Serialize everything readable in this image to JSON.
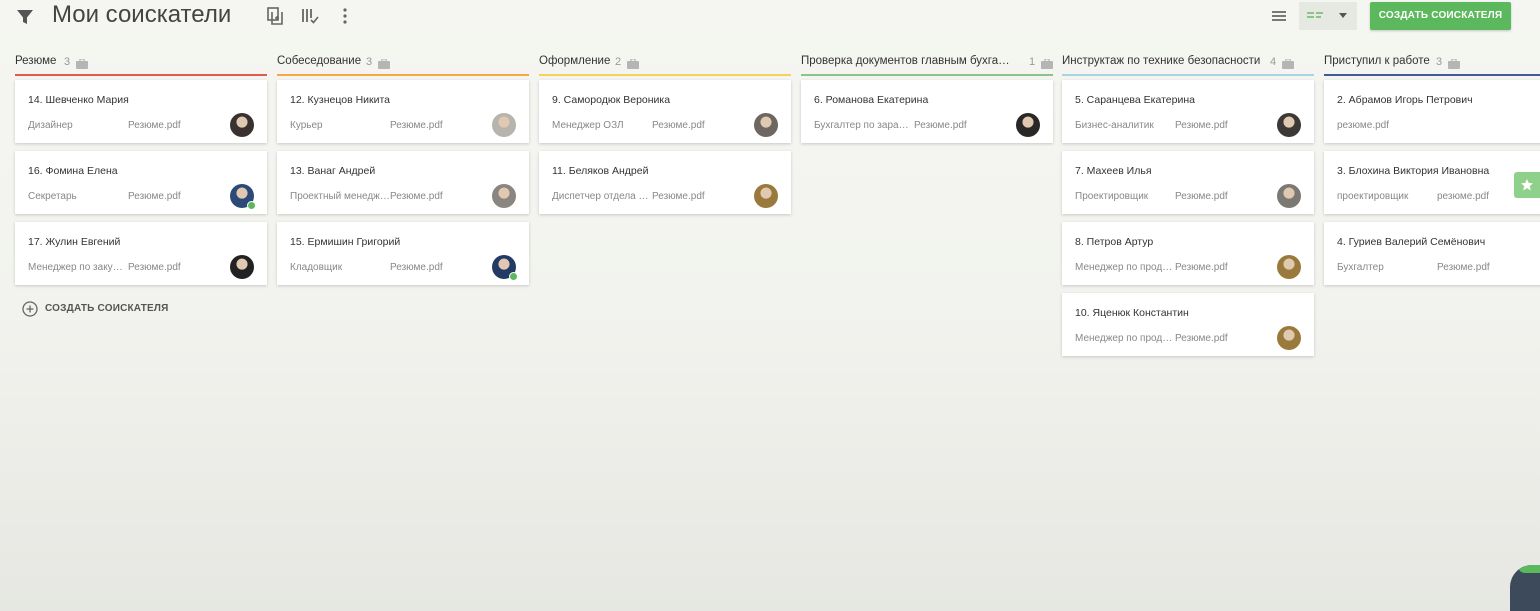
{
  "header": {
    "title": "Мои соискатели",
    "create_button": "СОЗДАТЬ СОИСКАТЕЛЯ"
  },
  "icons": {
    "filter": "filter-icon",
    "copy": "copy-icon",
    "columns": "columns-check-icon",
    "more": "more-vert-icon",
    "list_view": "list-view-icon",
    "board_view": "board-view-icon",
    "bag": "briefcase-icon",
    "star": "star-icon"
  },
  "colors": {
    "accent": "#5cb85c",
    "column_lines": [
      "#e05b4b",
      "#f5a742",
      "#f3d35a",
      "#8bc48a",
      "#a8d4e8",
      "#3f5a99"
    ]
  },
  "columns": [
    {
      "title": "Резюме",
      "count": "3",
      "cards": [
        {
          "name": "14. Шевченко Мария",
          "role": "Дизайнер",
          "resume": "Резюме.pdf",
          "avatar": "#3a3230",
          "online": false
        },
        {
          "name": "16. Фомина Елена",
          "role": "Секретарь",
          "resume": "Резюме.pdf",
          "avatar": "#2c4a78",
          "online": true
        },
        {
          "name": "17. Жулин Евгений",
          "role": "Менеджер по закупкам",
          "resume": "Резюме.pdf",
          "avatar": "#222222",
          "online": false
        }
      ]
    },
    {
      "title": "Собеседование",
      "count": "3",
      "cards": [
        {
          "name": "12. Кузнецов Никита",
          "role": "Курьер",
          "resume": "Резюме.pdf",
          "avatar": "#b7b4ad",
          "online": false
        },
        {
          "name": "13. Ванаг Андрей",
          "role": "Проектный менеджер",
          "resume": "Резюме.pdf",
          "avatar": "#8a8580",
          "online": false
        },
        {
          "name": "15. Ермишин Григорий",
          "role": "Кладовщик",
          "resume": "Резюме.pdf",
          "avatar": "#243a66",
          "online": true
        }
      ]
    },
    {
      "title": "Оформление",
      "count": "2",
      "cards": [
        {
          "name": "9. Самородюк Вероника",
          "role": "Менеджер ОЗЛ",
          "resume": "Резюме.pdf",
          "avatar": "#6e6660",
          "online": false
        },
        {
          "name": "11. Беляков Андрей",
          "role": "Диспетчер отдела логистики",
          "resume": "Резюме.pdf",
          "avatar": "#9a7a3c",
          "online": false
        }
      ]
    },
    {
      "title": "Проверка документов главным бухгалтером",
      "count": "1",
      "cards": [
        {
          "name": "6. Романова Екатерина",
          "role": "Бухгалтер по заработной плате",
          "resume": "Резюме.pdf",
          "avatar": "#2a2826",
          "online": false
        }
      ]
    },
    {
      "title": "Инструктаж по технике безопасности",
      "count": "4",
      "cards": [
        {
          "name": "5. Саранцева Екатерина",
          "role": "Бизнес-аналитик",
          "resume": "Резюме.pdf",
          "avatar": "#3c3836",
          "online": false
        },
        {
          "name": "7. Махеев Илья",
          "role": "Проектировщик",
          "resume": "Резюме.pdf",
          "avatar": "#7c7874",
          "online": false
        },
        {
          "name": "8. Петров Артур",
          "role": "Менеджер по продажам",
          "resume": "Резюме.pdf",
          "avatar": "#9a7a3c",
          "online": false
        },
        {
          "name": "10. Яценюк Константин",
          "role": "Менеджер по продажам",
          "resume": "Резюме.pdf",
          "avatar": "#9a7a3c",
          "online": false
        }
      ]
    },
    {
      "title": "Приступил к работе",
      "count": "3",
      "cards": [
        {
          "name": "2. Абрамов Игорь Петрович",
          "role": "резюме.pdf",
          "resume": "",
          "avatar": "",
          "online": false
        },
        {
          "name": "3. Блохина Виктория Ивановна",
          "role": "проектировщик",
          "resume": "резюме.pdf",
          "avatar": "",
          "online": false
        },
        {
          "name": "4. Гуриев Валерий Семёнович",
          "role": "Бухгалтер",
          "resume": "Резюме.pdf",
          "avatar": "",
          "online": false
        }
      ]
    }
  ],
  "add_candidate": "СОЗДАТЬ СОИСКАТЕЛЯ"
}
